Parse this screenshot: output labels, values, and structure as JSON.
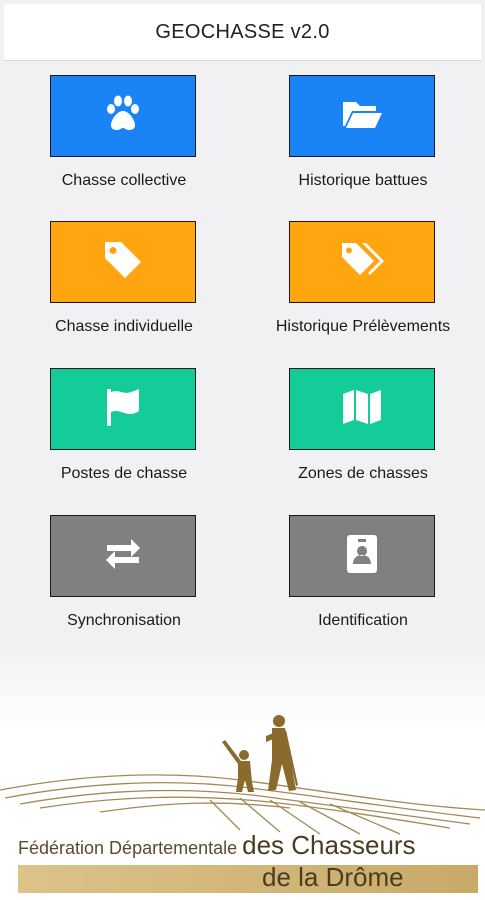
{
  "header": {
    "title": "GEOCHASSE v2.0"
  },
  "colors": {
    "blue": "#1a84f7",
    "orange": "#ffa50f",
    "green": "#14cc9a",
    "gray": "#808080"
  },
  "tiles": [
    {
      "label": "Chasse collective",
      "icon": "paw-icon",
      "color": "blue"
    },
    {
      "label": "Historique battues",
      "icon": "folder-open-icon",
      "color": "blue"
    },
    {
      "label": "Chasse individuelle",
      "icon": "tag-icon",
      "color": "orange"
    },
    {
      "label": "Historique Prélèvements",
      "icon": "tags-icon",
      "color": "orange"
    },
    {
      "label": "Postes de chasse",
      "icon": "flag-icon",
      "color": "green"
    },
    {
      "label": "Zones de chasses",
      "icon": "map-icon",
      "color": "green"
    },
    {
      "label": "Synchronisation",
      "icon": "exchange-icon",
      "color": "gray"
    },
    {
      "label": "Identification",
      "icon": "id-badge-icon",
      "color": "gray"
    }
  ],
  "footer": {
    "line1_small": "Fédération Départementale ",
    "line1_big": "des Chasseurs",
    "line2": "de la Drôme"
  }
}
